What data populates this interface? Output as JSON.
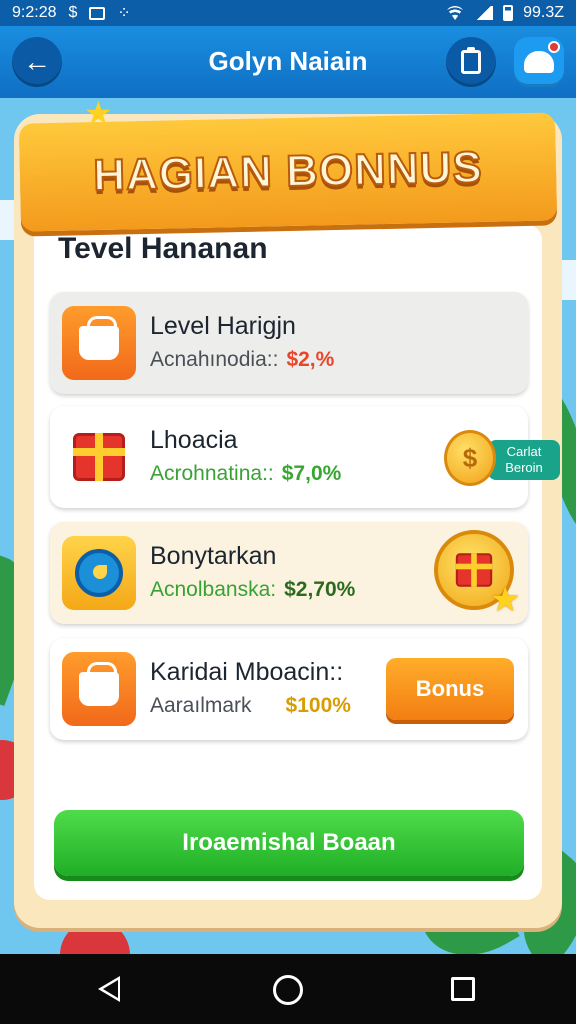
{
  "status_bar": {
    "time": "9:2:28",
    "battery": "99.3Z"
  },
  "app_bar": {
    "title": "Golyn Naiain",
    "back_icon": "arrow-left-icon",
    "clipboard_icon": "clipboard-icon",
    "notification_icon": "bell-icon"
  },
  "banner": {
    "title": "HAGIAN BONNUS"
  },
  "section": {
    "title": "Tevel Hananan"
  },
  "rewards": [
    {
      "name": "Level Harigjn",
      "sub_label": "Acnahınodia::",
      "value": "$2,%",
      "icon": "basket-icon"
    },
    {
      "name": "Lhoacia",
      "sub_label": "Acrohnatina::",
      "value": "$7,0%",
      "icon": "gift-box-icon",
      "action_label": "Carlat Beroin",
      "action_icon": "coin-icon"
    },
    {
      "name": "Bonytarkan",
      "sub_label": "Acnolbanska:",
      "value": "$2,70%",
      "icon": "clock-icon",
      "badge_icon": "gift-medal-icon"
    },
    {
      "name": "Karidai Mboacin::",
      "sub_label": "Aaraılmark",
      "value": "$100%",
      "icon": "shopping-basket-icon",
      "button_label": "Bonus"
    }
  ],
  "cta": {
    "label": "Iroaemishal Boaan"
  },
  "colors": {
    "app_bar": "#1a8ee0",
    "card": "#fbe7bd",
    "banner": "#ffc93c",
    "cta": "#1fae26",
    "bonus_button": "#f27e12"
  }
}
